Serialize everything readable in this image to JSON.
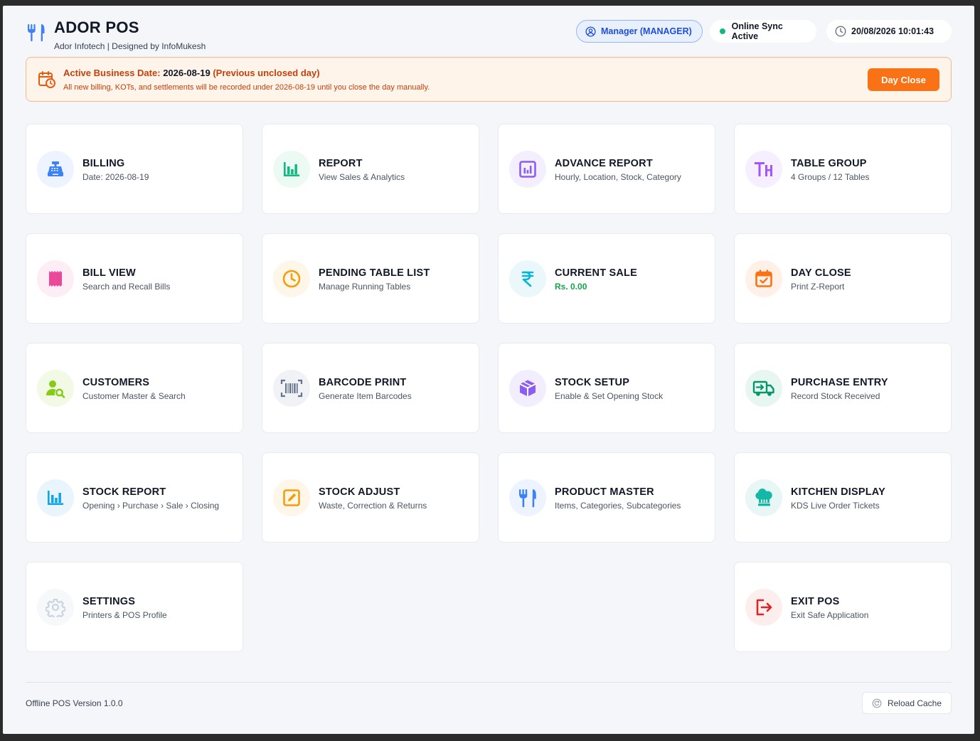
{
  "header": {
    "app_title": "ADOR POS",
    "app_subtitle": "Ador Infotech | Designed by InfoMukesh",
    "user_label": "Manager (MANAGER)",
    "sync_label": "Online Sync Active",
    "datetime": "20/08/2026 10:01:43"
  },
  "banner": {
    "prefix": "Active Business Date:",
    "date": "2026-08-19",
    "suffix": "(Previous unclosed day)",
    "message": "All new billing, KOTs, and settlements will be recorded under 2026-08-19 until you close the day manually.",
    "button_label": "Day Close"
  },
  "tiles": [
    {
      "title": "BILLING",
      "subtitle": "Date: 2026-08-19",
      "icon": "cash-register-icon",
      "color": "#3b82f6"
    },
    {
      "title": "REPORT",
      "subtitle": "View Sales & Analytics",
      "icon": "bar-chart-icon",
      "color": "#10b981"
    },
    {
      "title": "ADVANCE REPORT",
      "subtitle": "Hourly, Location, Stock, Category",
      "icon": "chart-box-icon",
      "color": "#8b5cf6"
    },
    {
      "title": "TABLE GROUP",
      "subtitle": "4 Groups / 12 Tables",
      "icon": "table-group-icon",
      "color": "#a855f7"
    },
    {
      "title": "BILL VIEW",
      "subtitle": "Search and Recall Bills",
      "icon": "receipt-icon",
      "color": "#ec4899"
    },
    {
      "title": "PENDING TABLE LIST",
      "subtitle": "Manage Running Tables",
      "icon": "clock-icon",
      "color": "#f59e0b"
    },
    {
      "title": "CURRENT SALE",
      "subtitle": "Rs. 0.00",
      "icon": "rupee-icon",
      "color": "#06b6d4"
    },
    {
      "title": "DAY CLOSE",
      "subtitle": "Print Z-Report",
      "icon": "calendar-check-icon",
      "color": "#f97316"
    },
    {
      "title": "CUSTOMERS",
      "subtitle": "Customer Master & Search",
      "icon": "user-search-icon",
      "color": "#84cc16"
    },
    {
      "title": "BARCODE PRINT",
      "subtitle": "Generate Item Barcodes",
      "icon": "barcode-icon",
      "color": "#64748b"
    },
    {
      "title": "STOCK SETUP",
      "subtitle": "Enable & Set Opening Stock",
      "icon": "box-icon",
      "color": "#8b5cf6"
    },
    {
      "title": "PURCHASE ENTRY",
      "subtitle": "Record Stock Received",
      "icon": "truck-icon",
      "color": "#059669"
    },
    {
      "title": "STOCK REPORT",
      "subtitle": "Opening › Purchase › Sale › Closing",
      "icon": "bar-chart-icon",
      "color": "#0ea5e9"
    },
    {
      "title": "STOCK ADJUST",
      "subtitle": "Waste, Correction & Returns",
      "icon": "edit-square-icon",
      "color": "#f59e0b"
    },
    {
      "title": "PRODUCT MASTER",
      "subtitle": "Items, Categories, Subcategories",
      "icon": "utensils-icon",
      "color": "#3b82f6"
    },
    {
      "title": "KITCHEN DISPLAY",
      "subtitle": "KDS Live Order Tickets",
      "icon": "chef-hat-icon",
      "color": "#14b8a6"
    },
    {
      "title": "SETTINGS",
      "subtitle": "Printers & POS Profile",
      "icon": "gear-icon",
      "color": "#cbd5e1"
    },
    {
      "title": "EXIT POS",
      "subtitle": "Exit Safe Application",
      "icon": "exit-icon",
      "color": "#dc2626"
    }
  ],
  "footer": {
    "version": "Offline POS Version 1.0.0",
    "reload_label": "Reload Cache"
  }
}
